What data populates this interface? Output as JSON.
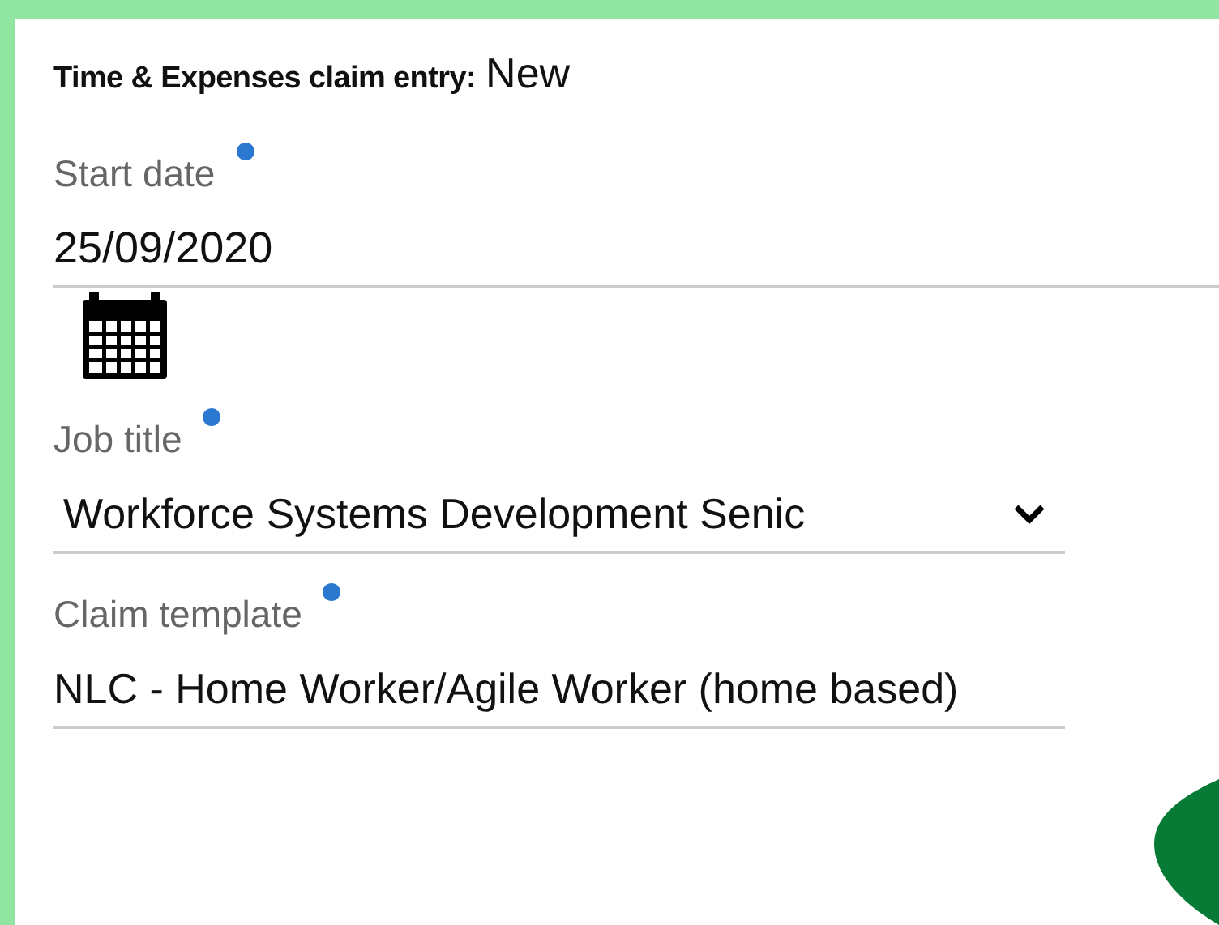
{
  "header": {
    "label": "Time & Expenses claim entry:",
    "value": "New"
  },
  "fields": [
    {
      "kind": "date",
      "label": "Start date",
      "required": true,
      "value": "25/09/2020"
    },
    {
      "kind": "select",
      "label": "Job title",
      "required": true,
      "value": "Workforce Systems Development Senic"
    },
    {
      "kind": "text",
      "label": "Claim template",
      "required": true,
      "value": "NLC - Home Worker/Agile Worker (home based)"
    }
  ]
}
